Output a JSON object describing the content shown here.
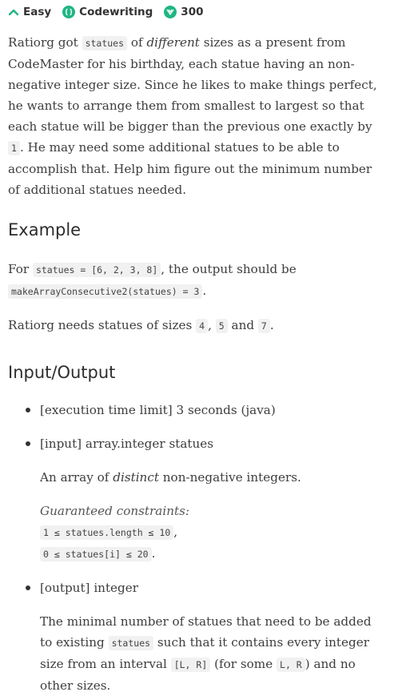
{
  "header": {
    "difficulty": "Easy",
    "category": "Codewriting",
    "points": "300",
    "colors": {
      "accent": "#1fb683"
    }
  },
  "description": {
    "p1_a": "Ratiorg got ",
    "p1_code": "statues",
    "p1_b": " of ",
    "p1_em": "different",
    "p1_c": " sizes as a present from CodeMaster for his birthday, each statue having an non-negative integer size. Since he likes to make things perfect, he wants to arrange them from smallest to largest so that each statue will be bigger than the previous one exactly by ",
    "p1_code2": "1",
    "p1_d": ". He may need some additional statues to be able to accomplish that. Help him figure out the minimum number of additional statues needed."
  },
  "example": {
    "heading": "Example",
    "line_a": "For ",
    "line_code1": "statues = [6, 2, 3, 8]",
    "line_b": ", the output should be",
    "line_code2": "makeArrayConsecutive2(statues) = 3",
    "line_c": ".",
    "note_a": "Ratiorg needs statues of sizes ",
    "note_code1": "4",
    "note_sep1": ", ",
    "note_code2": "5",
    "note_sep2": " and ",
    "note_code3": "7",
    "note_end": "."
  },
  "io": {
    "heading": "Input/Output",
    "time_limit": "[execution time limit] 3 seconds (java)",
    "input_head": "[input] array.integer statues",
    "input_desc_a": "An array of ",
    "input_desc_em": "distinct",
    "input_desc_b": " non-negative integers.",
    "constraints_label": "Guaranteed constraints:",
    "constraint1": "1 ≤ statues.length ≤ 10",
    "constraint1_end": ",",
    "constraint2": "0 ≤ statues[i] ≤ 20",
    "constraint2_end": ".",
    "output_head": "[output] integer",
    "output_a": "The minimal number of statues that need to be added to existing ",
    "output_code1": "statues",
    "output_b": " such that it contains every integer size from an interval ",
    "output_code2": "[L, R]",
    "output_c": " (for some ",
    "output_code3": "L, R",
    "output_d": ") and no other sizes."
  }
}
